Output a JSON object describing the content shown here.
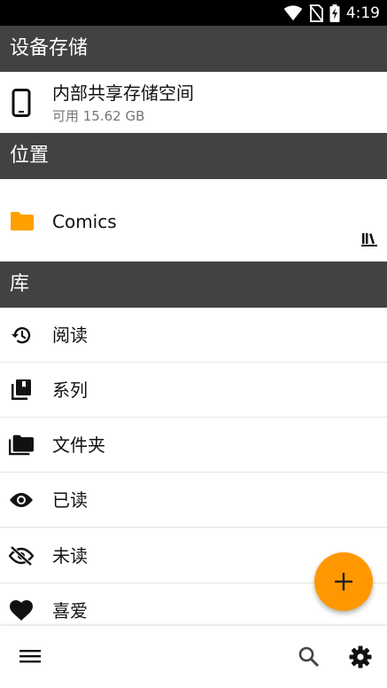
{
  "status_bar": {
    "time": "4:19"
  },
  "sections": {
    "device_storage": "设备存储",
    "locations": "位置",
    "library": "库"
  },
  "storage": {
    "title": "内部共享存储空间",
    "subtitle": "可用 15.62 GB"
  },
  "location": {
    "name": "Comics"
  },
  "library_items": [
    {
      "label": "阅读",
      "icon": "history-icon"
    },
    {
      "label": "系列",
      "icon": "series-book-icon"
    },
    {
      "label": "文件夹",
      "icon": "folders-icon"
    },
    {
      "label": "已读",
      "icon": "eye-icon"
    },
    {
      "label": "未读",
      "icon": "eye-off-icon"
    },
    {
      "label": "喜爱",
      "icon": "heart-icon"
    }
  ],
  "colors": {
    "accent": "#FF9800",
    "header": "#424242"
  }
}
